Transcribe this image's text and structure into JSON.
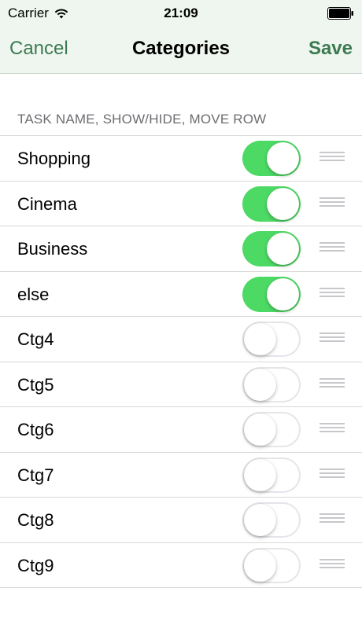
{
  "status_bar": {
    "carrier": "Carrier",
    "time": "21:09",
    "icons": [
      "wifi-icon",
      "battery-icon"
    ]
  },
  "nav": {
    "cancel_label": "Cancel",
    "title": "Categories",
    "save_label": "Save"
  },
  "section": {
    "header": "TASK NAME, SHOW/HIDE, MOVE ROW"
  },
  "rows": [
    {
      "label": "Shopping",
      "visible": true
    },
    {
      "label": "Cinema",
      "visible": true
    },
    {
      "label": "Business",
      "visible": true
    },
    {
      "label": "else",
      "visible": true
    },
    {
      "label": "Ctg4",
      "visible": false
    },
    {
      "label": "Ctg5",
      "visible": false
    },
    {
      "label": "Ctg6",
      "visible": false
    },
    {
      "label": "Ctg7",
      "visible": false
    },
    {
      "label": "Ctg8",
      "visible": false
    },
    {
      "label": "Ctg9",
      "visible": false
    }
  ],
  "colors": {
    "accent": "#3c7a52",
    "toggle_on": "#4cd964",
    "nav_background": "#eef6ef"
  }
}
